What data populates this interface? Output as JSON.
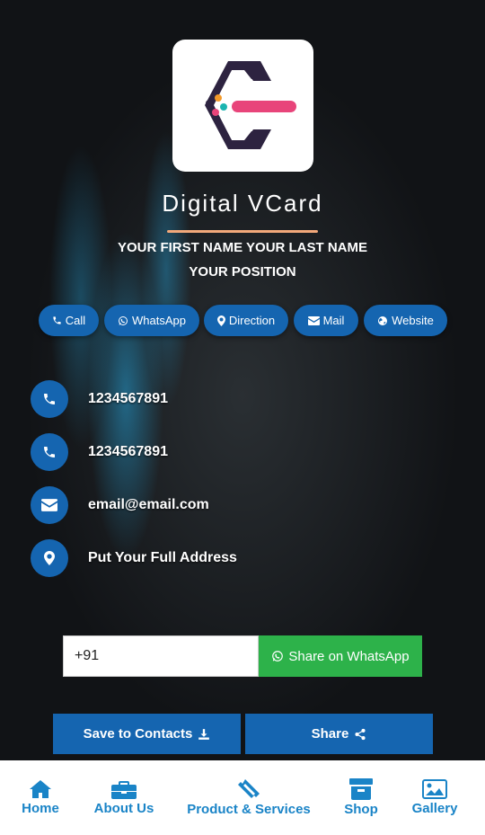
{
  "colors": {
    "accent": "#1565b0",
    "whatsapp": "#2db24a",
    "underline": "#f2a87a",
    "nav_text": "#1a84c7",
    "logo_dark": "#2d2340",
    "logo_pink": "#e8447a"
  },
  "header": {
    "title": "Digital VCard",
    "name": "YOUR FIRST NAME YOUR LAST NAME",
    "position": "YOUR POSITION"
  },
  "actions": [
    {
      "icon": "phone-icon",
      "label": "Call"
    },
    {
      "icon": "whatsapp-icon",
      "label": "WhatsApp"
    },
    {
      "icon": "map-marker-icon",
      "label": "Direction"
    },
    {
      "icon": "envelope-icon",
      "label": "Mail"
    },
    {
      "icon": "globe-icon",
      "label": "Website"
    }
  ],
  "contacts": [
    {
      "icon": "phone-icon",
      "text": "1234567891"
    },
    {
      "icon": "phone-icon",
      "text": "1234567891"
    },
    {
      "icon": "envelope-icon",
      "text": "email@email.com"
    },
    {
      "icon": "map-marker-icon",
      "text": "Put Your Full Address"
    }
  ],
  "share_whatsapp": {
    "input_value": "+91",
    "button_label": "Share on WhatsApp"
  },
  "buttons": {
    "save_label": "Save to Contacts",
    "share_label": "Share"
  },
  "nav": [
    {
      "icon": "home-icon",
      "label": "Home"
    },
    {
      "icon": "briefcase-icon",
      "label": "About Us"
    },
    {
      "icon": "ticket-icon",
      "label": "Product & Services"
    },
    {
      "icon": "archive-icon",
      "label": "Shop"
    },
    {
      "icon": "image-icon",
      "label": "Gallery"
    }
  ]
}
